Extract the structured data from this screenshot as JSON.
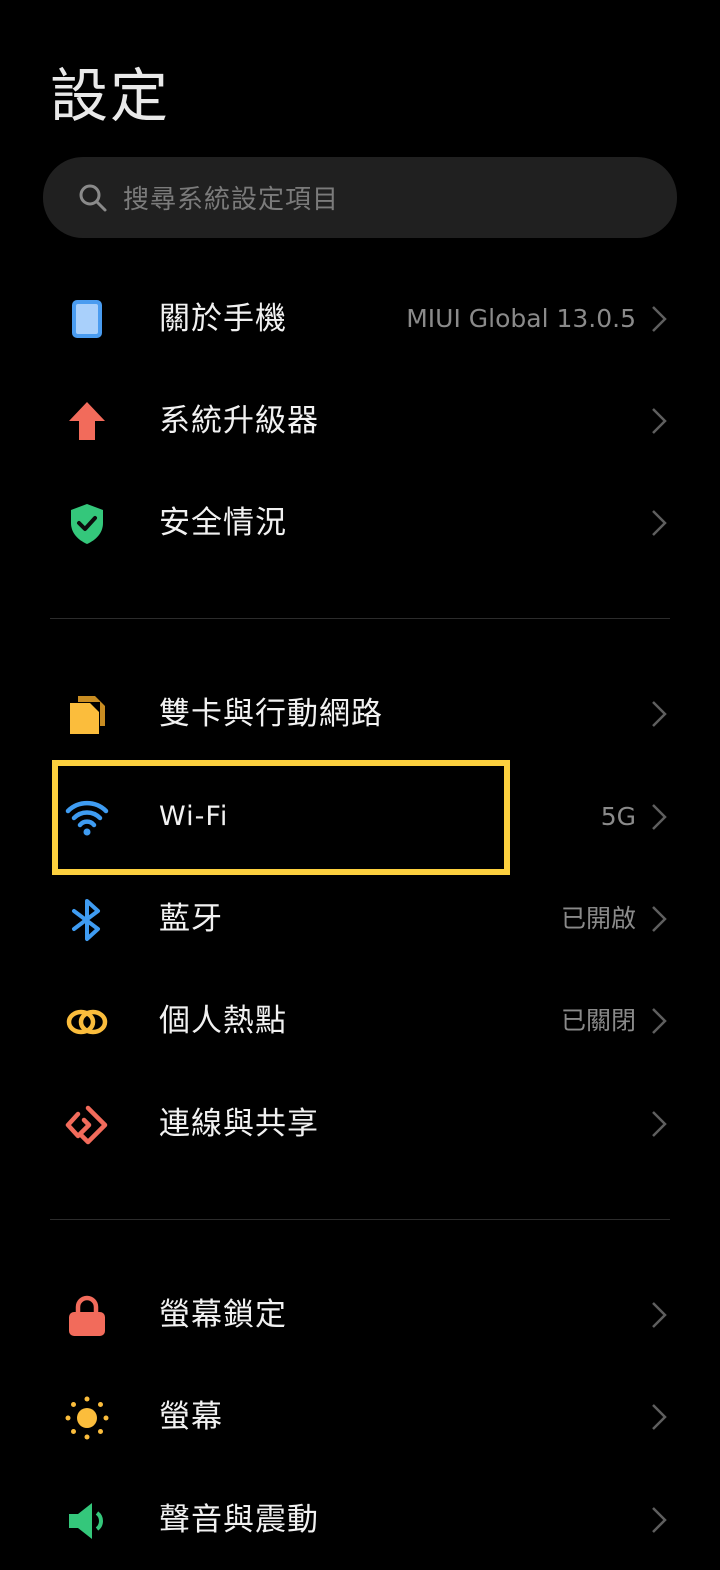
{
  "header": {
    "title": "設定"
  },
  "search": {
    "placeholder": "搜尋系統設定項目"
  },
  "items": [
    {
      "label": "關於手機",
      "value": "MIUI Global 13.0.5",
      "icon": "phone-icon",
      "color": "#4a9cf0"
    },
    {
      "label": "系統升級器",
      "value": "",
      "icon": "arrow-up-icon",
      "color": "#f26b5b"
    },
    {
      "label": "安全情況",
      "value": "",
      "icon": "shield-check-icon",
      "color": "#34c77b"
    },
    {
      "label": "雙卡與行動網路",
      "value": "",
      "icon": "sim-card-icon",
      "color": "#fbbd3c"
    },
    {
      "label": "Wi-Fi",
      "value": "5G",
      "icon": "wifi-icon",
      "color": "#3f9cf2"
    },
    {
      "label": "藍牙",
      "value": "已開啟",
      "icon": "bluetooth-icon",
      "color": "#3f9cf2"
    },
    {
      "label": "個人熱點",
      "value": "已關閉",
      "icon": "hotspot-icon",
      "color": "#fbbd3c"
    },
    {
      "label": "連線與共享",
      "value": "",
      "icon": "connection-sharing-icon",
      "color": "#f26b5b"
    },
    {
      "label": "螢幕鎖定",
      "value": "",
      "icon": "lock-icon",
      "color": "#f26b5b"
    },
    {
      "label": "螢幕",
      "value": "",
      "icon": "sun-icon",
      "color": "#fbbd3c"
    },
    {
      "label": "聲音與震動",
      "value": "",
      "icon": "speaker-icon",
      "color": "#34c77b"
    }
  ],
  "colors": {
    "background": "#000000",
    "highlight": "#fcd03e"
  }
}
